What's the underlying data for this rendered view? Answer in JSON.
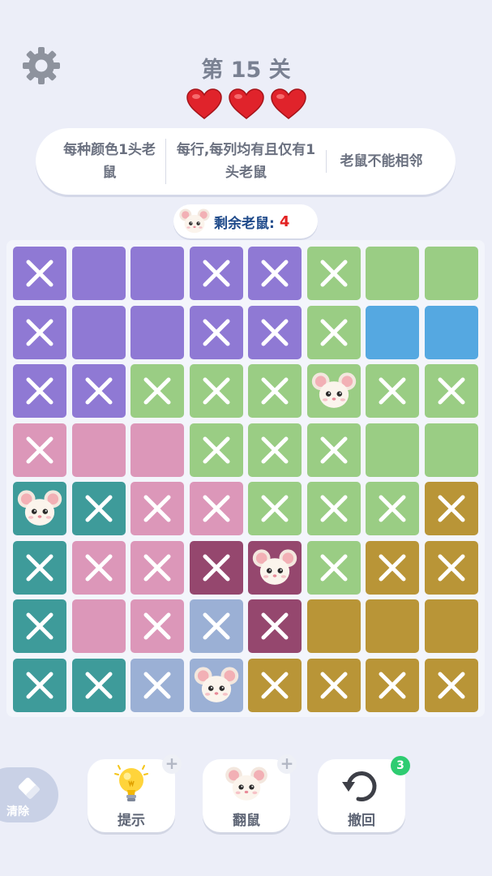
{
  "header": {
    "level_title": "第 15 关",
    "lives": 3
  },
  "rules": [
    "每种颜色1头老鼠",
    "每行,每列均有且仅有1头老鼠",
    "老鼠不能相邻"
  ],
  "remaining": {
    "label": "剩余老鼠:",
    "count": "4"
  },
  "colors": {
    "P": "#8f79d4",
    "G": "#9acd84",
    "B": "#55a8e1",
    "K": "#dc97b9",
    "T": "#3e9b9a",
    "M": "#95476e",
    "L": "#9bb0d5",
    "Y": "#b99537"
  },
  "board": {
    "rows": [
      [
        "P",
        "P",
        "P",
        "P",
        "P",
        "G",
        "G",
        "G"
      ],
      [
        "P",
        "P",
        "P",
        "P",
        "P",
        "G",
        "B",
        "B"
      ],
      [
        "P",
        "P",
        "G",
        "G",
        "G",
        "G",
        "G",
        "G"
      ],
      [
        "K",
        "K",
        "K",
        "G",
        "G",
        "G",
        "G",
        "G"
      ],
      [
        "T",
        "T",
        "K",
        "K",
        "G",
        "G",
        "G",
        "Y"
      ],
      [
        "T",
        "K",
        "K",
        "M",
        "M",
        "G",
        "Y",
        "Y"
      ],
      [
        "T",
        "K",
        "K",
        "L",
        "M",
        "Y",
        "Y",
        "Y"
      ],
      [
        "T",
        "T",
        "L",
        "L",
        "Y",
        "Y",
        "Y",
        "Y"
      ]
    ],
    "marks": [
      "x..xxx..",
      "x..xxx..",
      "xxxxxmxx",
      "x..xxx..",
      "mxxxxxxx",
      "xxxxmxxx",
      "x.xxx...",
      "xxxmxxxx"
    ]
  },
  "toolbar": {
    "erase_label": "清除",
    "hint_label": "提示",
    "flip_label": "翻鼠",
    "undo_label": "撤回",
    "undo_count": "3",
    "plus": "+"
  }
}
